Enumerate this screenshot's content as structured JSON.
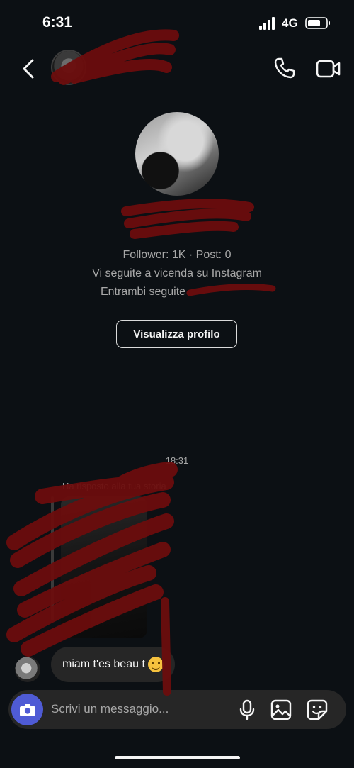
{
  "status_bar": {
    "time": "6:31",
    "network": "4G"
  },
  "header": {
    "name": ""
  },
  "profile": {
    "name": "",
    "handle": "",
    "stats": "Follower: 1K · Post: 0",
    "mutual_text": "Vi seguite a vicenda su Instagram",
    "followed_by_text": "Entrambi seguite",
    "view_profile_label": "Visualizza profilo"
  },
  "conversation": {
    "timestamp": "18:31",
    "story_reply_label": "Ha risposto alla tua storia",
    "message_text": "miam t'es beau t"
  },
  "composer": {
    "placeholder": "Scrivi un messaggio..."
  },
  "colors": {
    "background": "#0c1014",
    "bubble": "#262626",
    "camera_button": "#4f5bd5",
    "redaction": "#6b0d0d"
  },
  "icons": [
    "back-icon",
    "phone-icon",
    "video-camera-icon",
    "camera-icon",
    "microphone-icon",
    "gallery-icon",
    "sticker-icon"
  ]
}
